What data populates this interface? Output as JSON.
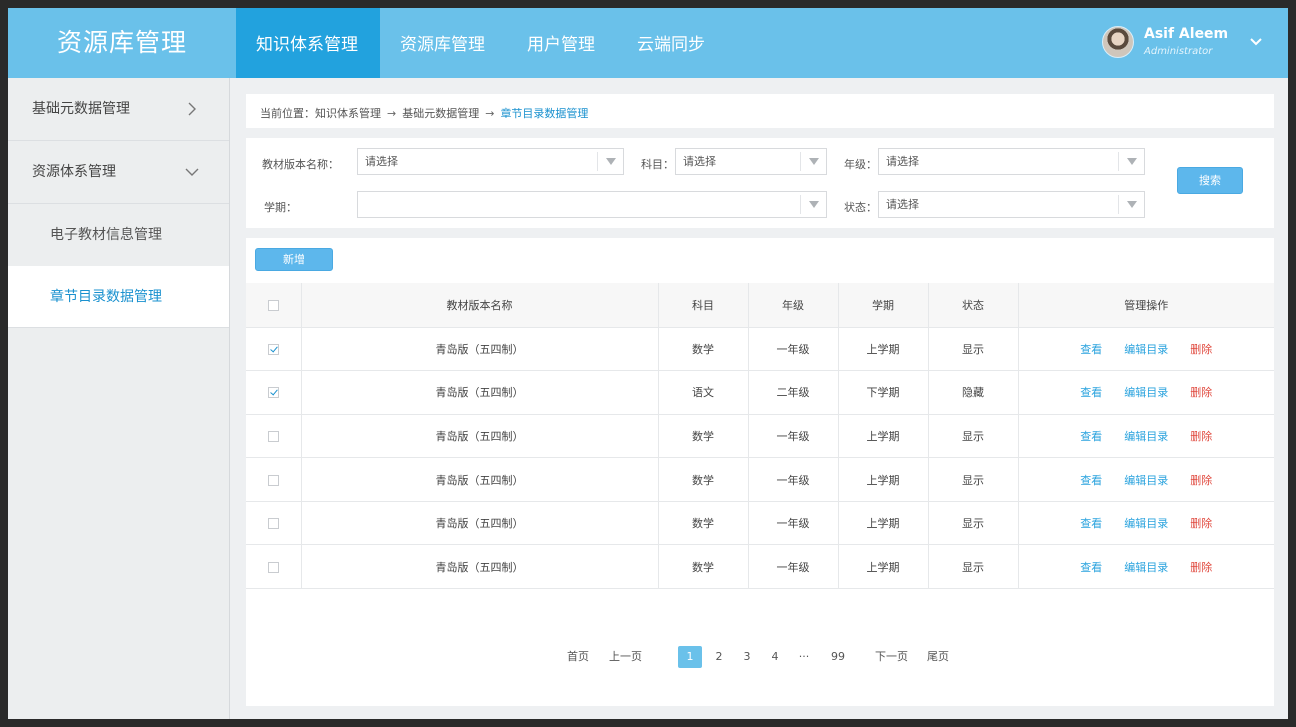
{
  "app": {
    "title": "资源库管理"
  },
  "nav": {
    "items": [
      {
        "label": "知识体系管理"
      },
      {
        "label": "资源库管理"
      },
      {
        "label": "用户管理"
      },
      {
        "label": "云端同步"
      }
    ]
  },
  "user": {
    "name": "Asif Aleem",
    "role": "Administrator"
  },
  "sidebar": {
    "group1": "基础元数据管理",
    "group2": "资源体系管理",
    "sub1": "电子教材信息管理",
    "sub2": "章节目录数据管理"
  },
  "breadcrumb": {
    "prefix": "当前位置：",
    "level1": "知识体系管理",
    "level2": "基础元数据管理",
    "current": "章节目录数据管理",
    "sep": "→"
  },
  "filters": {
    "edition_label": "教材版本名称：",
    "edition_value": "请选择",
    "subject_label": "科目：",
    "subject_value": "请选择",
    "grade_label": "年级：",
    "grade_value": "请选择",
    "term_label": "学期：",
    "term_value": "",
    "status_label": "状态：",
    "status_value": "请选择",
    "search_label": "搜索"
  },
  "toolbar": {
    "add_label": "新增"
  },
  "table": {
    "headers": [
      "教材版本名称",
      "科目",
      "年级",
      "学期",
      "状态",
      "管理操作"
    ],
    "ops": {
      "view": "查看",
      "edit": "编辑目录",
      "delete": "删除"
    },
    "rows": [
      {
        "checked": true,
        "name": "青岛版（五四制）",
        "subject": "数学",
        "grade": "一年级",
        "term": "上学期",
        "status": "显示"
      },
      {
        "checked": true,
        "name": "青岛版（五四制）",
        "subject": "语文",
        "grade": "二年级",
        "term": "下学期",
        "status": "隐藏"
      },
      {
        "checked": false,
        "name": "青岛版（五四制）",
        "subject": "数学",
        "grade": "一年级",
        "term": "上学期",
        "status": "显示"
      },
      {
        "checked": false,
        "name": "青岛版（五四制）",
        "subject": "数学",
        "grade": "一年级",
        "term": "上学期",
        "status": "显示"
      },
      {
        "checked": false,
        "name": "青岛版（五四制）",
        "subject": "数学",
        "grade": "一年级",
        "term": "上学期",
        "status": "显示"
      },
      {
        "checked": false,
        "name": "青岛版（五四制）",
        "subject": "数学",
        "grade": "一年级",
        "term": "上学期",
        "status": "显示"
      }
    ]
  },
  "pagination": {
    "first": "首页",
    "prev": "上一页",
    "pages": [
      "1",
      "2",
      "3",
      "4",
      "···",
      "99"
    ],
    "current": "1",
    "next": "下一页",
    "last": "尾页"
  },
  "colors": {
    "primary": "#6ac1ea",
    "active_nav": "#22a2de",
    "link": "#2aa3de",
    "danger": "#e0483d"
  }
}
